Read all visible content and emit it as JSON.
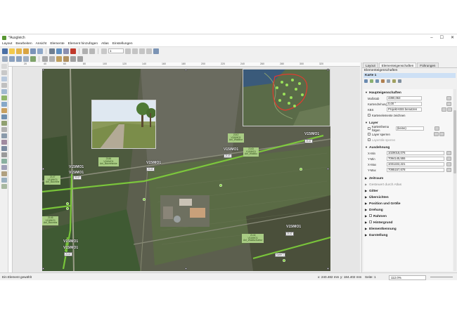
{
  "window": {
    "title": "*Ausgleich",
    "controls": [
      "–",
      "☐",
      "✕"
    ]
  },
  "menu": [
    "Layout",
    "Bearbeiten",
    "Ansicht",
    "Elemente",
    "Element hinzufügen",
    "Atlas",
    "Einstellungen"
  ],
  "toolbar": {
    "page_number": "1"
  },
  "ruler": {
    "ticks": [
      "20",
      "40",
      "60",
      "80",
      "100",
      "120",
      "140",
      "160",
      "180",
      "200",
      "220",
      "240",
      "260",
      "280",
      "300",
      "320"
    ]
  },
  "map": {
    "v_labels": [
      "V15/MO1",
      "V15/MO1",
      "V15/MO1",
      "V15/MO1",
      "V15/MO1",
      "V15/MO1",
      "V15/MO1",
      "V15/MO1"
    ],
    "boxes": [
      "2145\nV15/MO1\nAnl_Baumhe",
      "2147\nV15/MO1\nAnl_Baumhe",
      "2146\nV15/MO1\nAnl_Baumhecke",
      "2142\nV15/MO1\nAnl_Waldkur",
      "2143\nV15/MO1\nAnl_Waldku",
      "2144\nV15/MO1\nAnl_Waldschurkur"
    ],
    "numbers": [
      "2142",
      "2143",
      "2143",
      "2142",
      "2142",
      "2142",
      "2143",
      "2143"
    ],
    "frame_label": "Karte 1"
  },
  "panel": {
    "tabs": [
      "Layout",
      "Elementeigenschaften",
      "Führungen"
    ],
    "title": "Elementeigenschaften",
    "item_name": "Karte 1",
    "main_section": "Haupteigenschaften",
    "fields": {
      "scale_label": "Maßstab",
      "scale_value": "4390,063",
      "rotation_label": "Kartendrehung",
      "rotation_value": "0,00 °",
      "crs_label": "KBS",
      "crs_value": "Projekt-KBS benutzen",
      "draw_items": "Kartenelemente zeichnen"
    },
    "layers_section": "Layer",
    "layers": {
      "follow_theme": "Kartenthema folgen",
      "follow_theme_value": "(keine)",
      "lock_layers": "Layer sperren",
      "lock_styles": "Layerstile sperren"
    },
    "extent_section": "Ausdehnung",
    "extent": {
      "xmin_label": "X-Min",
      "xmin_value": "1029018,076",
      "ymin_label": "Y-Min",
      "ymin_value": "7094145,555",
      "xmax_label": "X-Max",
      "xmax_value": "1031222,221",
      "ymax_label": "Y-Max",
      "ymax_value": "7095157,678"
    },
    "collapsed_sections": [
      "Zeitraum",
      "Gesteuert durch Atlas",
      "Gitter",
      "Übersichten",
      "Position und Größe",
      "Drehung",
      "Rahmen",
      "Hintergrund",
      "Elementkennung",
      "Darstellung"
    ]
  },
  "status": {
    "message": "Ein Element gewählt",
    "x": "x: 240.482 mm",
    "y": "y: 184.402 mm",
    "page": "Seite: 1",
    "zoom": "112.0%"
  },
  "colors": {
    "accent_green": "#7fd13b",
    "label_green": "#a9cc84",
    "selection": "#cde0f5"
  }
}
